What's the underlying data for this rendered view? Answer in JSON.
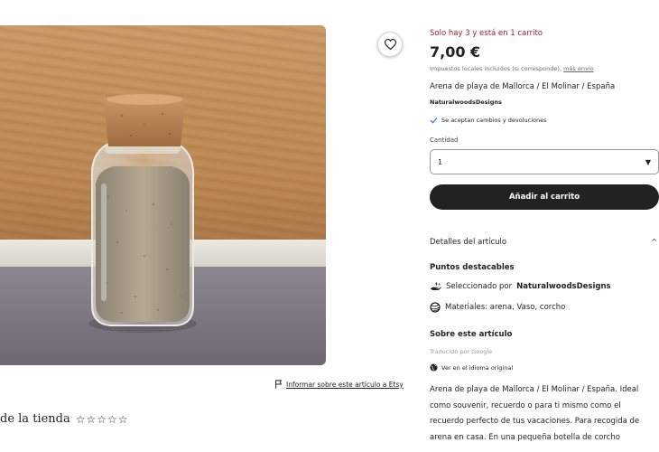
{
  "product": {
    "stock_notice": "Solo hay 3 y está en 1 carrito",
    "price": "7,00 €",
    "taxes_text": "Impuestos locales incluidos (si corresponde),",
    "shipping_link": "más envío",
    "title": "Arena de playa de Mallorca / El Molinar / España",
    "seller": "NaturalwoodsDesigns",
    "returns": "Se aceptan cambios y devoluciones",
    "quantity_label": "Cantidad",
    "quantity_value": "1",
    "add_to_cart": "Añadir al carrito"
  },
  "details": {
    "header": "Detalles del artículo",
    "highlights_title": "Puntos destacables",
    "curated_prefix": "Seleccionado por",
    "curated_by": "NaturalwoodsDesigns",
    "materials": "Materiales: arena, Vaso, corcho",
    "about_title": "Sobre este artículo",
    "translated": "Traducido por Google",
    "original_language": "Ver en el idioma original",
    "description_lines": [
      "Arena de playa de Mallorca / El Molinar / España. Ideal",
      "como souvenir, recuerdo o para ti mismo como el",
      "recuerdo perfecto de tus vacaciones. Para recogida de",
      "arena en casa. En una pequeña botella de corcho"
    ]
  },
  "left": {
    "report_link": "Informar sobre este artículo a Etsy",
    "shop_reviews": "de la tienda",
    "stars": "☆☆☆☆☆"
  },
  "icons": {
    "favorite": "heart-icon",
    "returns": "check-icon",
    "report": "flag-icon",
    "curated": "etsy-hand-icon",
    "materials": "yarn-icon",
    "language": "globe-icon",
    "dropdown": "caret-down-icon",
    "collapse": "chevron-up-icon"
  },
  "colors": {
    "stock_red": "#a61a2e",
    "button_dark": "#222222",
    "check_blue": "#2c76c9"
  }
}
